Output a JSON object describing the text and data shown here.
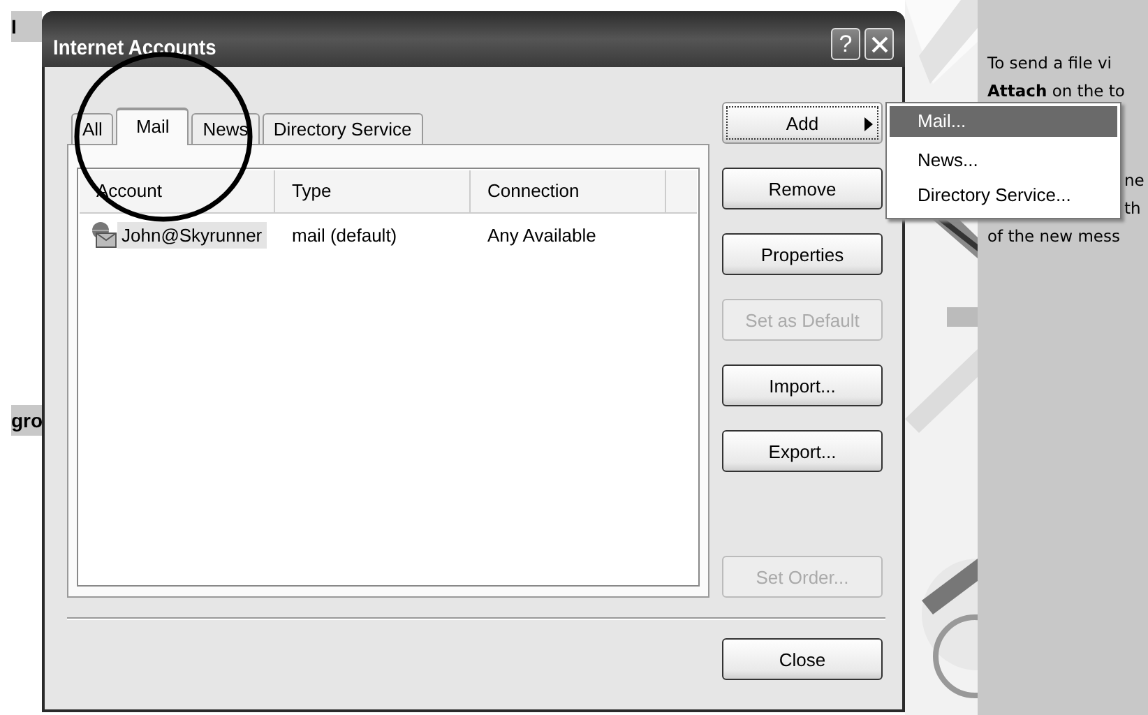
{
  "background_page": {
    "left_texts": [
      "I",
      "gro"
    ],
    "right_panel": {
      "lines": [
        {
          "text": "To send a file vi",
          "covered": false
        },
        {
          "text": "**Attach** on the to",
          "covered": false
        },
        {
          "text": "ne",
          "covered": true
        },
        {
          "text": "th",
          "covered": true
        },
        {
          "text": "of the new mess",
          "covered": false
        }
      ]
    }
  },
  "dialog": {
    "title": "Internet Accounts",
    "help_button": "?",
    "tabs": [
      {
        "label": "All",
        "selected": false
      },
      {
        "label": "Mail",
        "selected": true
      },
      {
        "label": "News",
        "selected": false
      },
      {
        "label": "Directory Service",
        "selected": false
      }
    ],
    "list": {
      "columns": [
        "Account",
        "Type",
        "Connection"
      ],
      "rows": [
        {
          "cells": [
            "John@Skyrunner",
            "mail (default)",
            "Any Available"
          ],
          "selected": true
        }
      ]
    },
    "buttons": [
      {
        "label": "Add",
        "disabled": false,
        "focused": true,
        "submenu": true
      },
      {
        "label": "Remove",
        "disabled": false,
        "focused": false,
        "submenu": false
      },
      {
        "label": "Properties",
        "disabled": false,
        "focused": false,
        "submenu": false
      },
      {
        "label": "Set as Default",
        "disabled": true,
        "focused": false,
        "submenu": false
      },
      {
        "label": "Import...",
        "disabled": false,
        "focused": false,
        "submenu": false
      },
      {
        "label": "Export...",
        "disabled": false,
        "focused": false,
        "submenu": false
      },
      {
        "label": "Set Order...",
        "disabled": true,
        "focused": false,
        "submenu": false
      }
    ],
    "close_button": "Close"
  },
  "add_menu": {
    "items": [
      {
        "label": "Mail...",
        "selected": true
      },
      {
        "label": "News...",
        "selected": false
      },
      {
        "label": "Directory Service...",
        "selected": false
      }
    ]
  },
  "annotation": {
    "kind": "circle"
  }
}
